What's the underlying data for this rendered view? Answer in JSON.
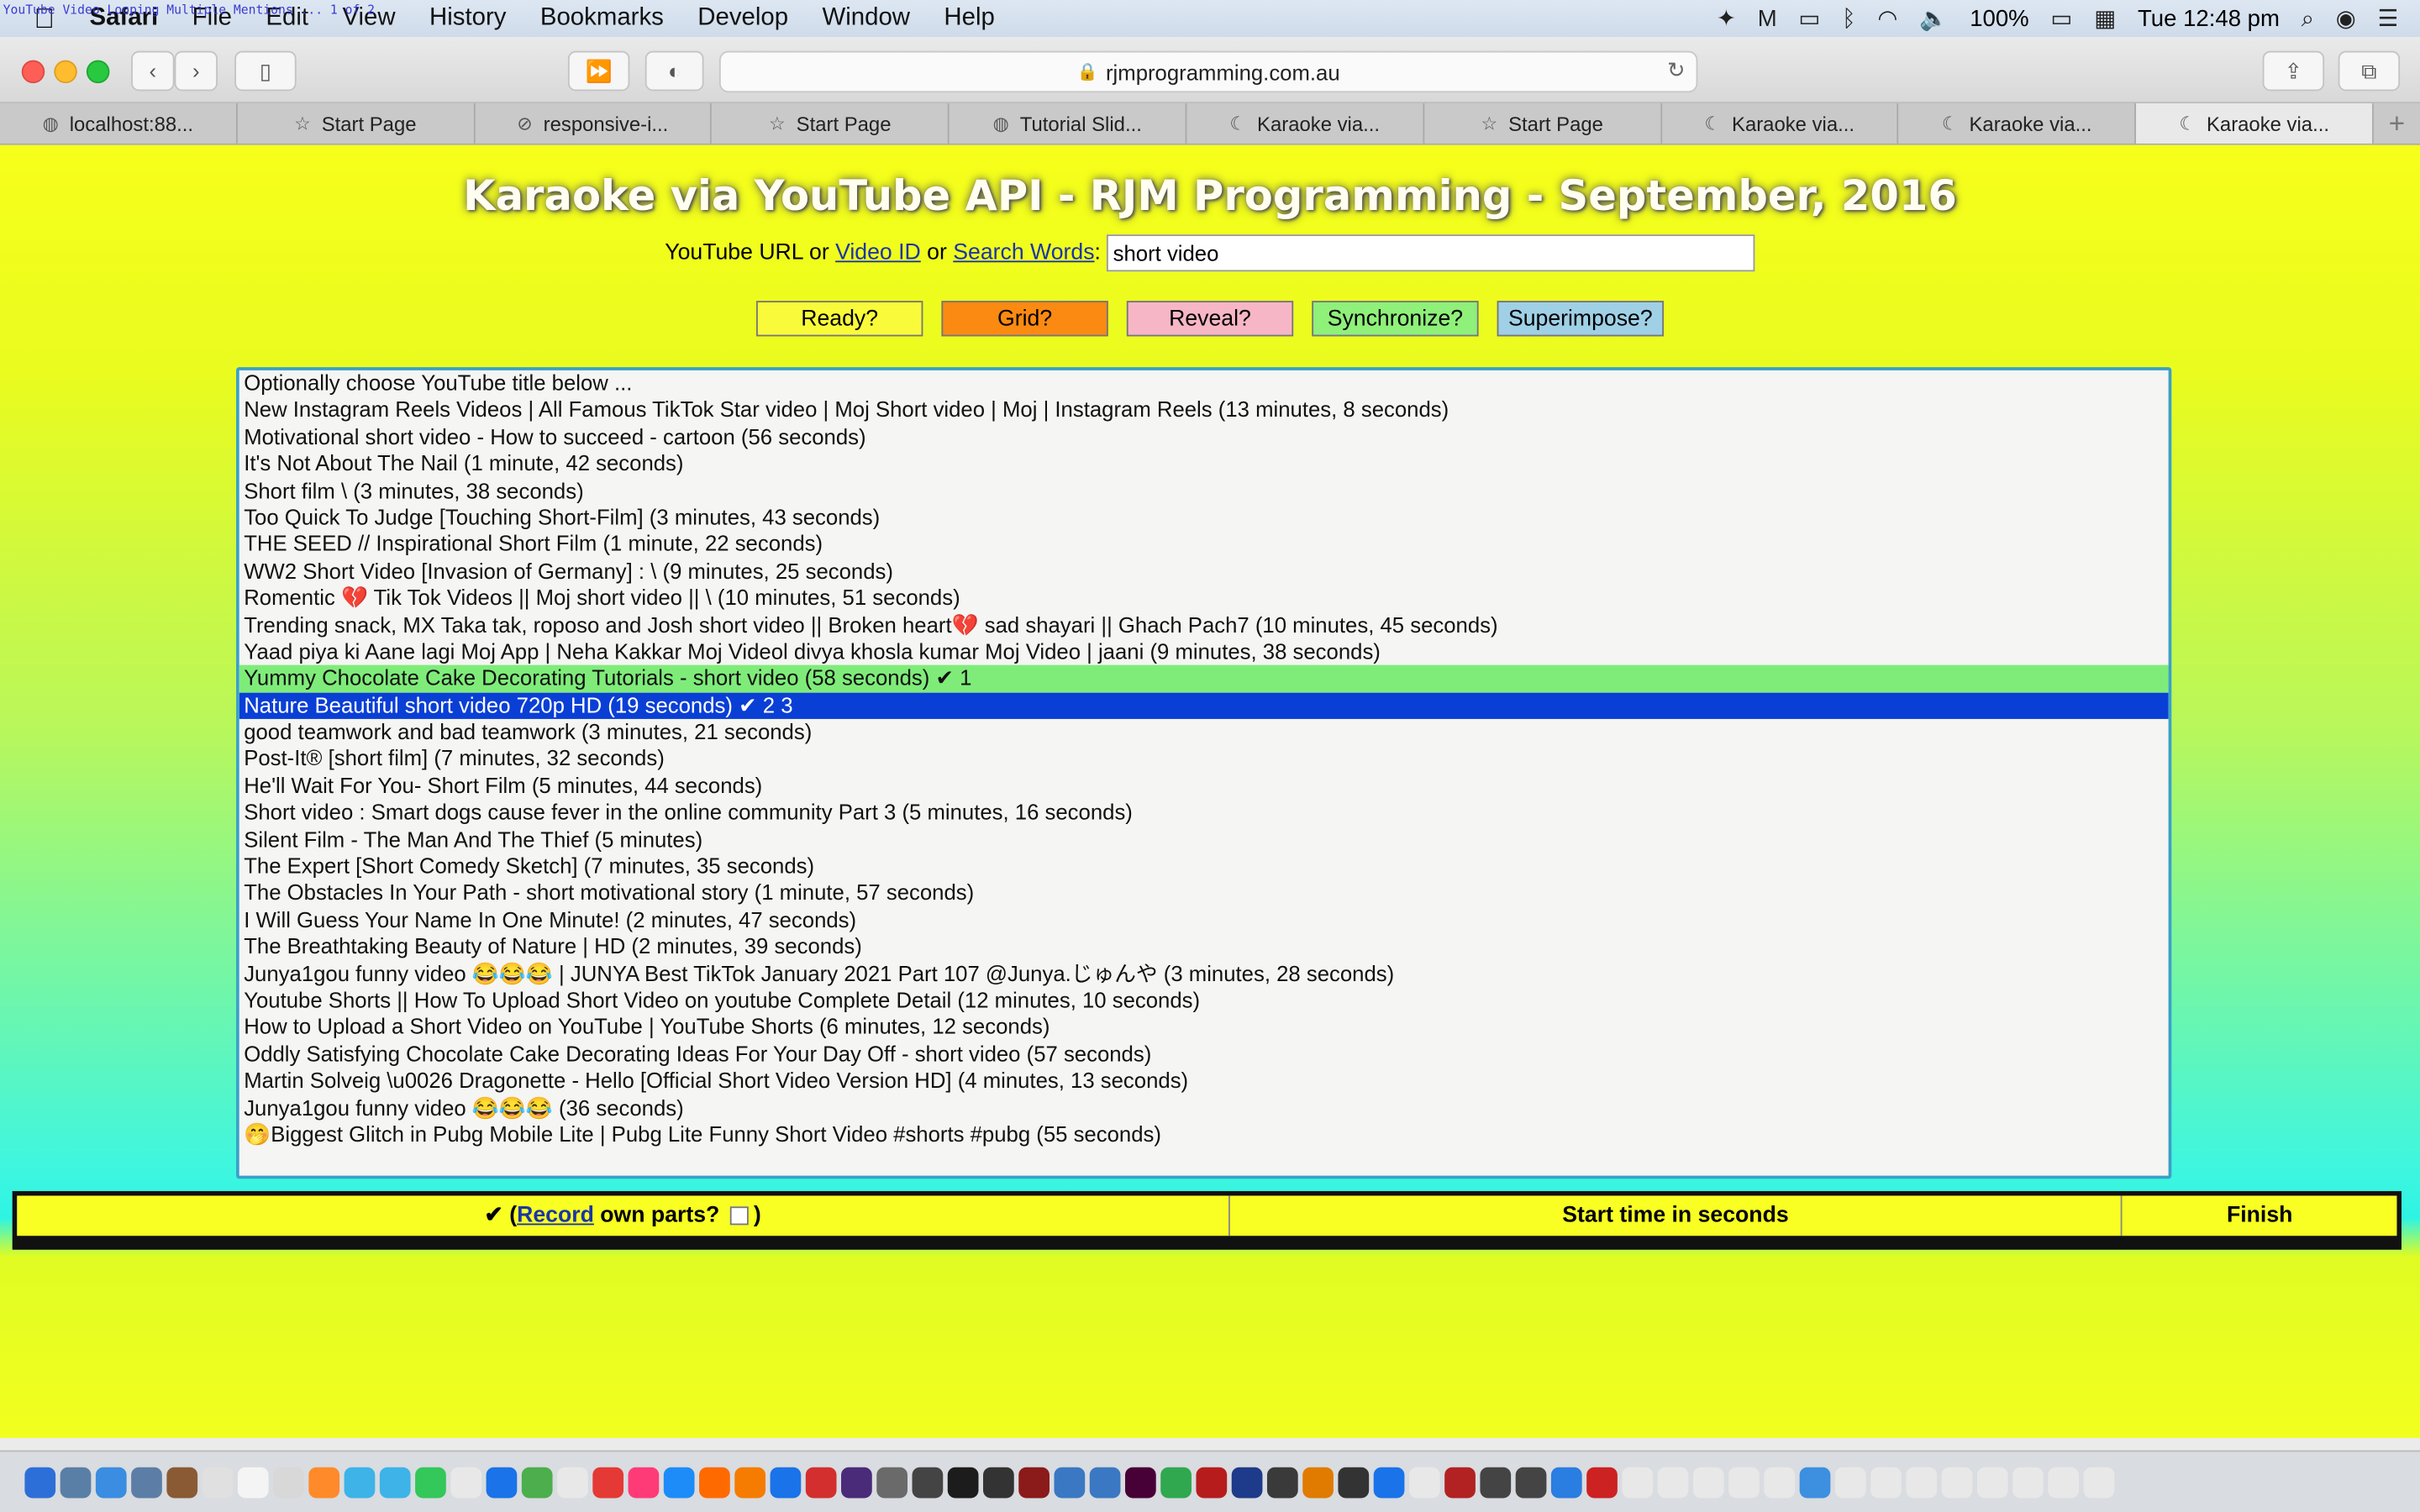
{
  "menubar": {
    "overlay_text": "YouTube Video Looping Multiple Mentions ... 1 of 2",
    "app_name": "Safari",
    "items": [
      "File",
      "Edit",
      "View",
      "History",
      "Bookmarks",
      "Develop",
      "Window",
      "Help"
    ],
    "battery": "100%",
    "clock": "Tue 12:48 pm"
  },
  "toolbar": {
    "url": "rjmprogramming.com.au"
  },
  "tabs": [
    {
      "label": "localhost:88...",
      "icon": "globe-icon"
    },
    {
      "label": "Start Page",
      "icon": "star-icon"
    },
    {
      "label": "responsive-i...",
      "icon": "compass-icon"
    },
    {
      "label": "Start Page",
      "icon": "star-icon"
    },
    {
      "label": "Tutorial Slid...",
      "icon": "globe-icon"
    },
    {
      "label": "Karaoke via...",
      "icon": "moon-icon"
    },
    {
      "label": "Start Page",
      "icon": "star-icon"
    },
    {
      "label": "Karaoke via...",
      "icon": "moon-icon"
    },
    {
      "label": "Karaoke via...",
      "icon": "moon-icon"
    },
    {
      "label": "Karaoke via...",
      "icon": "moon-icon"
    }
  ],
  "page": {
    "title": "Karaoke via YouTube API - RJM Programming - September, 2016",
    "search_prefix": "YouTube URL or ",
    "video_id_link": "Video ID",
    "or_text": " or ",
    "search_words_link": "Search Words",
    "colon": ":",
    "search_value": "short video",
    "buttons": {
      "ready": "Ready?",
      "grid": "Grid?",
      "reveal": "Reveal?",
      "synchronize": "Synchronize?",
      "superimpose": "Superimpose?"
    },
    "button_colors": {
      "ready": "#f9fb3a",
      "grid": "#fb8a12",
      "reveal": "#f7b6c6",
      "synchronize": "#8ff07a",
      "superimpose": "#9fd0e6"
    },
    "options": [
      "Optionally choose YouTube title below ...",
      "New Instagram Reels Videos | All Famous TikTok Star video | Moj Short video | Moj | Instagram Reels (13 minutes, 8 seconds)",
      "Motivational short video - How to succeed - cartoon (56 seconds)",
      "It's Not About The Nail (1 minute, 42 seconds)",
      "Short film \\ (3 minutes, 38 seconds)",
      "Too Quick To Judge [Touching Short-Film] (3 minutes, 43 seconds)",
      "THE SEED // Inspirational Short Film (1 minute, 22 seconds)",
      "WW2 Short Video [Invasion of Germany] : \\ (9 minutes, 25 seconds)",
      "Romentic 💔 Tik Tok Videos || Moj short video || \\ (10 minutes, 51 seconds)",
      "Trending snack, MX Taka tak, roposo and Josh short video || Broken heart💔 sad shayari || Ghach Pach7 (10 minutes, 45 seconds)",
      "Yaad piya ki Aane lagi Moj App | Neha Kakkar Moj Videol divya khosla kumar Moj Video | jaani (9 minutes, 38 seconds)",
      "Yummy Chocolate Cake Decorating Tutorials - short video (58 seconds) ✔ 1",
      "Nature Beautiful short video 720p HD (19 seconds) ✔ 2 3",
      "good teamwork and bad teamwork (3 minutes, 21 seconds)",
      "Post-It® [short film] (7 minutes, 32 seconds)",
      "He'll Wait For You- Short Film (5 minutes, 44 seconds)",
      "Short video : Smart dogs cause fever in the online community Part 3 (5 minutes, 16 seconds)",
      "Silent Film - The Man And The Thief (5 minutes)",
      "The Expert [Short Comedy Sketch] (7 minutes, 35 seconds)",
      "The Obstacles In Your Path - short motivational story (1 minute, 57 seconds)",
      "I Will Guess Your Name In One Minute! (2 minutes, 47 seconds)",
      "The Breathtaking Beauty of Nature | HD (2 minutes, 39 seconds)",
      "Junya1gou funny video 😂😂😂 | JUNYA Best TikTok January 2021 Part 107 @Junya.じゅんや (3 minutes, 28 seconds)",
      "Youtube Shorts || How To Upload Short Video on youtube Complete Detail (12 minutes, 10 seconds)",
      "How to Upload a Short Video on YouTube | YouTube Shorts (6 minutes, 12 seconds)",
      "Oddly Satisfying Chocolate Cake Decorating Ideas For Your Day Off - short video (57 seconds)",
      "Martin Solveig \\u0026 Dragonette - Hello [Official Short Video Version HD] (4 minutes, 13 seconds)",
      "Junya1gou funny video 😂😂😂 (36 seconds)",
      "🤭Biggest Glitch in Pubg Mobile Lite | Pubg Lite Funny Short Video #shorts #pubg (55 seconds)"
    ],
    "green_option_index": 11,
    "selected_option_index": 12,
    "table": {
      "check": "✔ (",
      "record_link": "Record",
      "own_parts": " own parts? ",
      "close_paren": ")",
      "start_time": "Start time in seconds",
      "finish": "Finish"
    }
  }
}
